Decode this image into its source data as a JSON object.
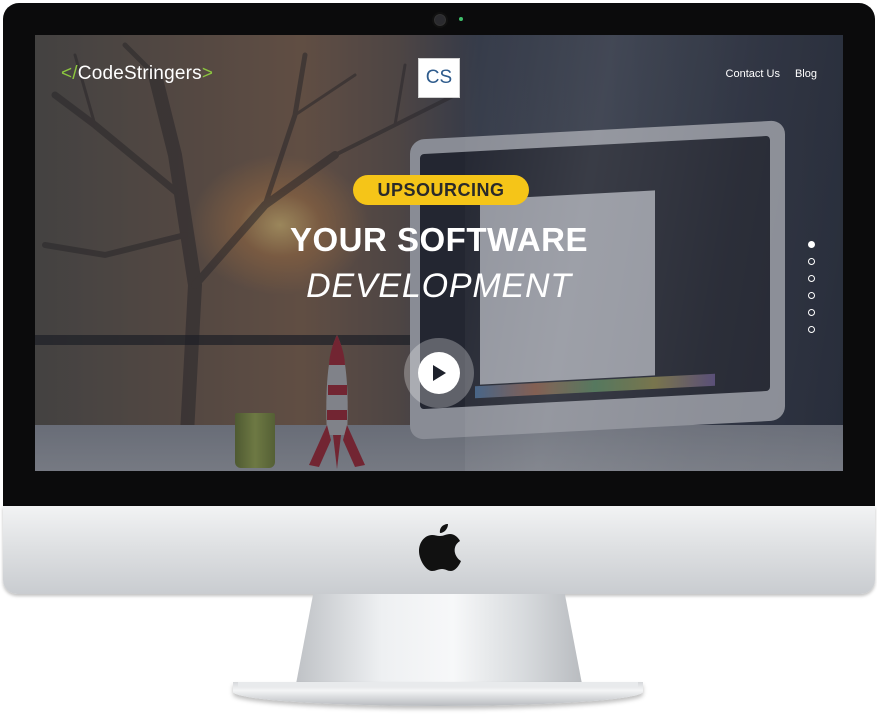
{
  "brand": {
    "logo_prefix": "</",
    "logo_text": "CodeStringers",
    "logo_suffix": ">",
    "badge": "CS",
    "accent_color": "#8cc63f"
  },
  "nav": {
    "items": [
      {
        "label": "Contact Us"
      },
      {
        "label": "Blog"
      }
    ]
  },
  "hero": {
    "tag": "UPSOURCING",
    "tag_color": "#f5c518",
    "headline": "YOUR SOFTWARE",
    "subline": "DEVELOPMENT",
    "play_icon": "play-icon"
  },
  "slider": {
    "total": 6,
    "active": 1
  },
  "device": {
    "logo_icon": "apple-logo-icon"
  }
}
